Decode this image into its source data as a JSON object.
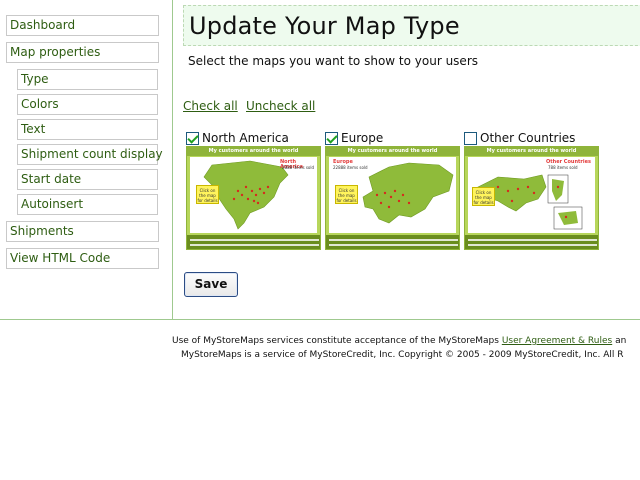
{
  "sidebar": {
    "items": [
      {
        "label": "Dashboard"
      },
      {
        "label": "Map properties"
      },
      {
        "label": "Type"
      },
      {
        "label": "Colors"
      },
      {
        "label": "Text"
      },
      {
        "label": "Shipment count display"
      },
      {
        "label": "Start date"
      },
      {
        "label": "Autoinsert"
      },
      {
        "label": "Shipments"
      },
      {
        "label": "View HTML Code"
      }
    ]
  },
  "main": {
    "title": "Update Your Map Type",
    "instructions": "Select the maps you want to show to your users",
    "check_all": "Check all",
    "uncheck_all": "Uncheck all",
    "maps": [
      {
        "label": "North America",
        "checked": true,
        "banner": "My customers around the world",
        "region_title": "North America",
        "sold_text": "2888 items sold",
        "click_text": "Click on the map for details"
      },
      {
        "label": "Europe",
        "checked": true,
        "banner": "My customers around the world",
        "region_title": "Europe",
        "sold_text": "22888 items sold",
        "click_text": "Click on the map for details"
      },
      {
        "label": "Other Countries",
        "checked": false,
        "banner": "My customers around the world",
        "region_title": "Other Countries",
        "sold_text": "788 items sold",
        "click_text": "Click on the map for details"
      }
    ],
    "save_label": "Save"
  },
  "footer": {
    "line1_prefix": "Use of MyStoreMaps services constitute acceptance of the MyStoreMaps ",
    "line1_link": "User Agreement & Rules",
    "line1_suffix": " an",
    "line2": "MyStoreMaps is a service of MyStoreCredit, Inc. Copyright © 2005 - 2009 MyStoreCredit, Inc. All R"
  },
  "colors": {
    "accent_green": "#2e5d12",
    "map_green": "#b7d65b",
    "title_bg": "#eefbee"
  }
}
